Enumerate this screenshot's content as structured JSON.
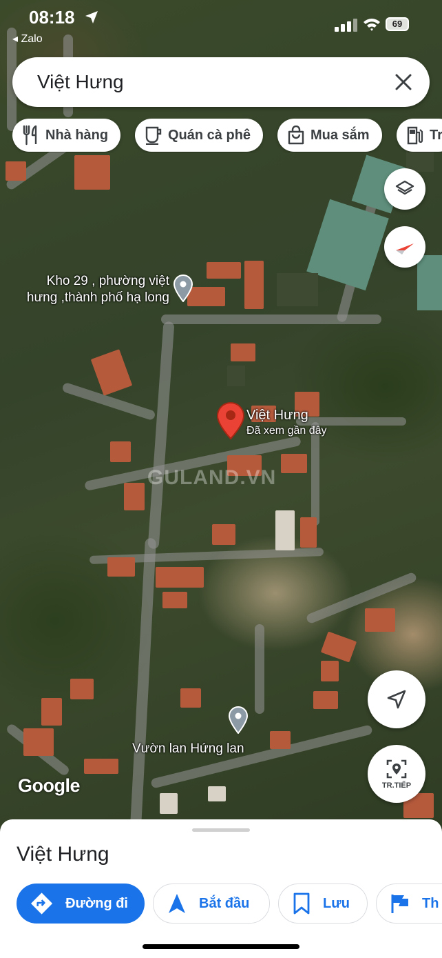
{
  "status_bar": {
    "time": "08:18",
    "back_app": "◂ Zalo",
    "battery": "69"
  },
  "search": {
    "query": "Việt Hưng"
  },
  "chips": [
    {
      "label": "Nhà hàng",
      "icon": "fork-knife-icon"
    },
    {
      "label": "Quán cà phê",
      "icon": "coffee-cup-icon"
    },
    {
      "label": "Mua sắm",
      "icon": "shopping-bag-icon"
    },
    {
      "label": "Tr",
      "icon": "gas-station-icon"
    }
  ],
  "map": {
    "poi_1_line1": "Kho 29 , phường việt",
    "poi_1_line2": "hưng ,thành phố hạ long",
    "selected_name": "Việt Hưng",
    "selected_sub": "Đã xem gần đây",
    "poi_2": "Vườn lan Hứng lan",
    "watermark": "GULAND.VN",
    "google_logo": "Google",
    "layers_icon": "layers-icon",
    "compass_icon": "compass-icon",
    "my_location_icon": "navigation-arrow-icon",
    "live_view_label": "TR.TIẾP"
  },
  "sheet": {
    "title": "Việt Hưng",
    "actions": [
      {
        "label": "Đường đi",
        "icon": "directions-icon"
      },
      {
        "label": "Bắt đầu",
        "icon": "navigation-start-icon"
      },
      {
        "label": "Lưu",
        "icon": "bookmark-icon"
      },
      {
        "label": "Th",
        "icon": "flag-icon"
      }
    ]
  },
  "colors": {
    "accent": "#1a73e8",
    "pin_red": "#ea4335",
    "pin_gray": "#8c9aa5"
  }
}
